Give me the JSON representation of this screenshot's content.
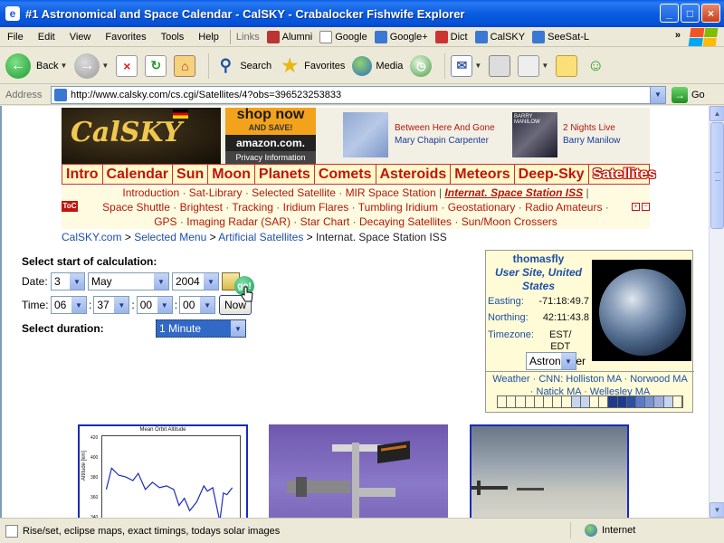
{
  "window": {
    "title": "#1 Astronomical and Space Calendar - CalSKY - Crabalocker Fishwife Explorer",
    "minimize": "_",
    "maximize": "□",
    "close": "×"
  },
  "menu": {
    "items": [
      "File",
      "Edit",
      "View",
      "Favorites",
      "Tools",
      "Help"
    ],
    "links_label": "Links",
    "links": [
      "Alumni",
      "Google",
      "Google+",
      "Dict",
      "CalSKY",
      "SeeSat-L"
    ],
    "more": "»"
  },
  "toolbar": {
    "back": "Back",
    "search": "Search",
    "favorites": "Favorites",
    "media": "Media"
  },
  "address": {
    "label": "Address",
    "url": "http://www.calsky.com/cs.cgi/Satellites/4?obs=396523253833",
    "go": "Go"
  },
  "status": {
    "text": "Rise/set, eclipse maps, exact timings, todays solar images",
    "zone": "Internet"
  },
  "banner": {
    "logo": "CalSKY",
    "ad_shop_line1": "shop now",
    "ad_shop_line2": "AND SAVE!",
    "ad_amazon": "amazon.com.",
    "ad_privacy": "Privacy Information",
    "album1_title": "Between Here And Gone",
    "album1_artist": "Mary Chapin Carpenter",
    "album2_cover": "BARRY MANILOW",
    "album2_title": "2 Nights Live",
    "album2_artist": "Barry Manilow"
  },
  "nav": {
    "categories": [
      "Intro",
      "Calendar",
      "Sun",
      "Moon",
      "Planets",
      "Comets",
      "Asteroids",
      "Meteors",
      "Deep-Sky",
      "Satellites"
    ],
    "active": "Satellites",
    "toc": "ToC",
    "row1": [
      "Introduction",
      "Sat-Library",
      "Selected Satellite",
      "MIR Space Station"
    ],
    "row1_current": "Internat. Space Station ISS",
    "row2": [
      "Space Shuttle",
      "Brightest",
      "Tracking",
      "Iridium Flares",
      "Tumbling Iridium",
      "Geostationary",
      "Radio Amateurs"
    ],
    "row3": [
      "GPS",
      "Imaging Radar (SAR)",
      "Star Chart",
      "Decaying Satellites",
      "Sun/Moon Crossers"
    ]
  },
  "breadcrumb": {
    "items": [
      "CalSKY.com",
      "Selected Menu",
      "Artificial Satellites"
    ],
    "current": "Internat. Space Station ISS",
    "sep": ">"
  },
  "form": {
    "start_label": "Select start of calculation:",
    "date_label": "Date:",
    "day": "3",
    "month": "May",
    "year": "2004",
    "time_label": "Time:",
    "hour": "06",
    "minute": "37",
    "second": "00",
    "frac": "00",
    "time_sep": ":",
    "now": "Now",
    "duration_label": "Select duration:",
    "duration": "1 Minute",
    "go": "go!"
  },
  "user": {
    "name": "thomasfly",
    "site": "User Site, United States",
    "easting_label": "Easting:",
    "easting": "-71:18:49.7",
    "northing_label": "Northing:",
    "northing": "42:11:43.8",
    "tz_label": "Timezone:",
    "tz_line1": "EST/",
    "tz_line2": "EDT",
    "view_mode": "Astronomer",
    "weather_label": "Weather",
    "wx1": [
      "CNN: Holliston MA",
      "Norwood MA"
    ],
    "wx2": [
      "Natick MA",
      "Wellesley MA"
    ]
  },
  "chart": {
    "title": "Mean Orbit Altitude",
    "ylabel": "Altitude [km]",
    "ticks": [
      "420",
      "400",
      "380",
      "360",
      "340"
    ]
  },
  "colors": {
    "brand_red": "#c0150b",
    "link_blue": "#1e4fa7",
    "xp_blue": "#0a5de0"
  }
}
